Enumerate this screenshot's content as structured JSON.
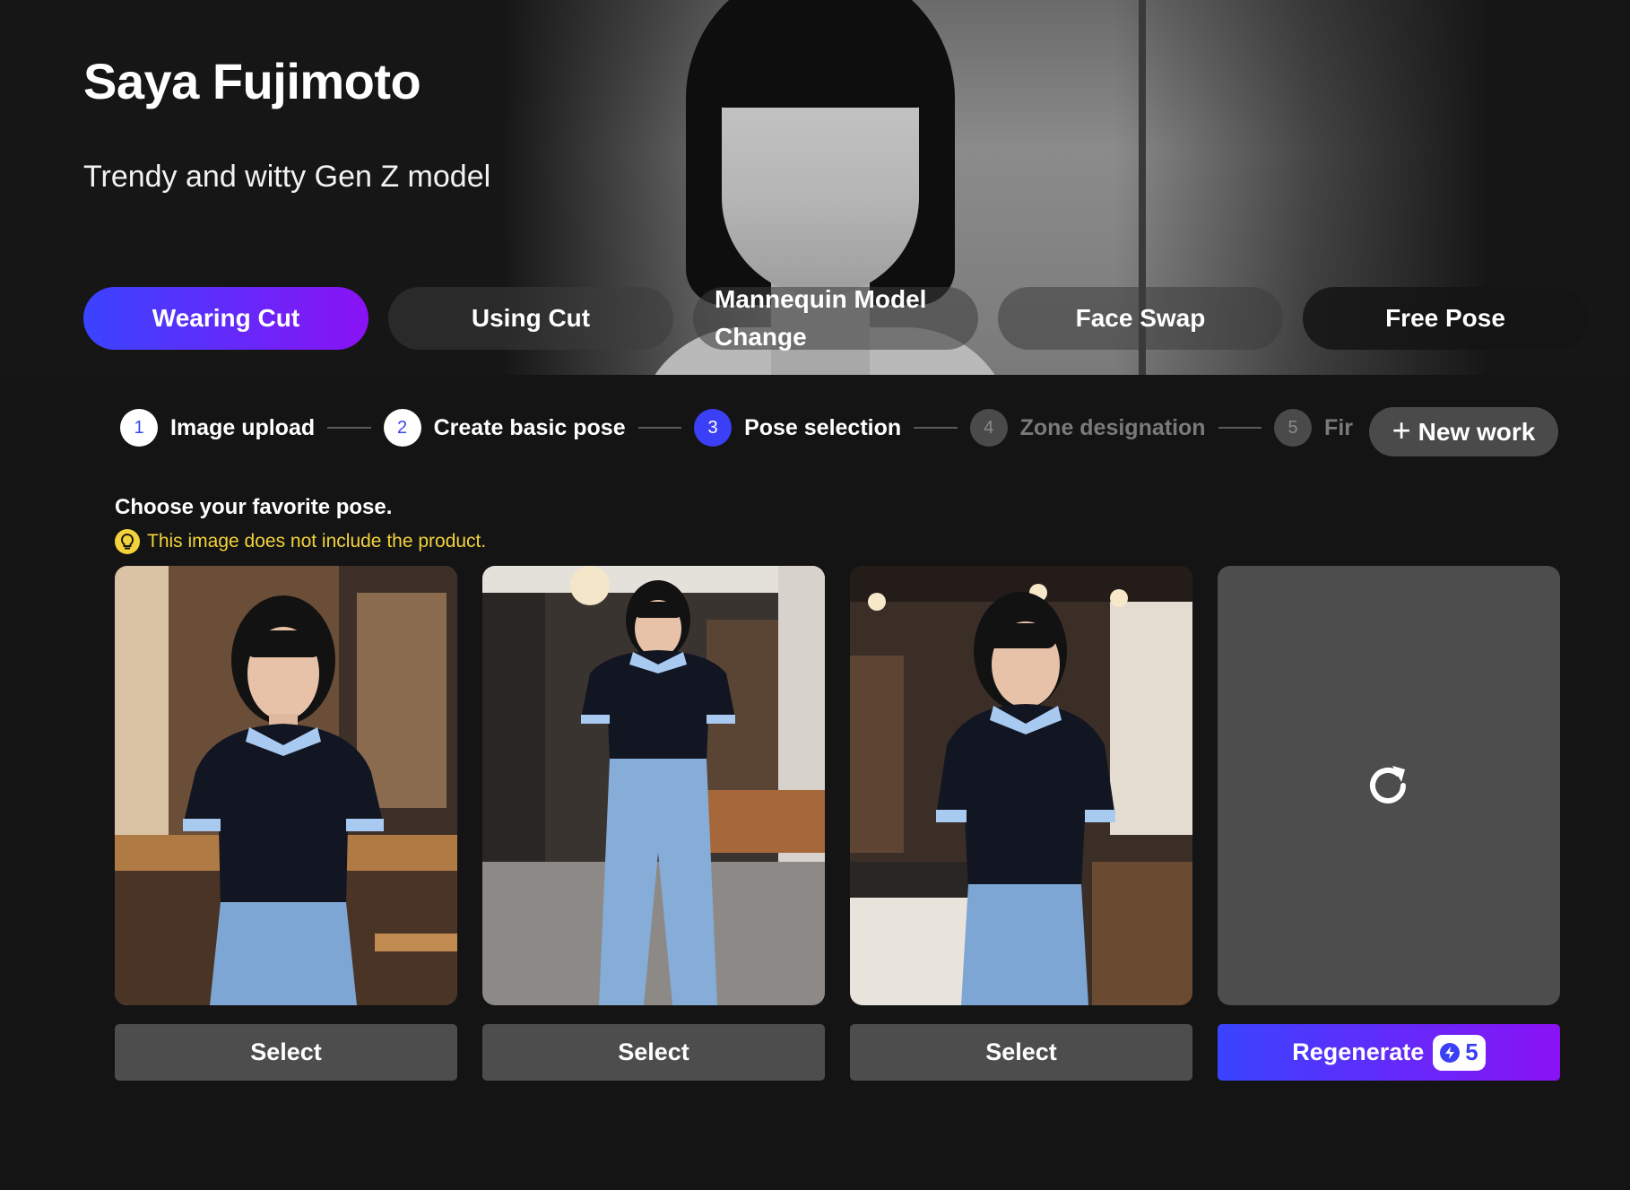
{
  "model": {
    "name": "Saya Fujimoto",
    "description": "Trendy and witty Gen Z model"
  },
  "mode_tabs": [
    {
      "label": "Wearing Cut",
      "active": true
    },
    {
      "label": "Using Cut",
      "active": false
    },
    {
      "label": "Mannequin Model Change",
      "line1": "Mannequin Model",
      "line2": "Change",
      "active": false
    },
    {
      "label": "Face Swap",
      "active": false
    },
    {
      "label": "Free Pose",
      "active": false
    }
  ],
  "steps": [
    {
      "number": "1",
      "label": "Image upload",
      "state": "done"
    },
    {
      "number": "2",
      "label": "Create basic pose",
      "state": "done"
    },
    {
      "number": "3",
      "label": "Pose selection",
      "state": "current"
    },
    {
      "number": "4",
      "label": "Zone designation",
      "state": "todo"
    },
    {
      "number": "5",
      "label": "Fir",
      "state": "todo"
    }
  ],
  "new_work_label": "New work",
  "instruction": "Choose your favorite pose.",
  "notice": "This image does not include the product.",
  "pose_cards": [
    {
      "select_label": "Select"
    },
    {
      "select_label": "Select"
    },
    {
      "select_label": "Select"
    }
  ],
  "regenerate": {
    "label": "Regenerate",
    "credits": "5"
  },
  "colors": {
    "background": "#141414",
    "accent_start": "#3a44ff",
    "accent_end": "#8a12f4",
    "notice_yellow": "#f3d33a",
    "button_gray": "#4d4d4d"
  }
}
